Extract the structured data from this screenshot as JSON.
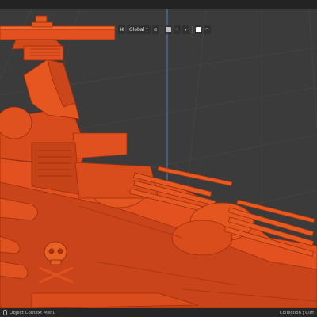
{
  "header_tools": {
    "transform_orientation": "Global",
    "transform_orientation_icon": "orientation-icon",
    "chevron_icon": "chevron-down-icon",
    "pivot_icon": "pivot-icon",
    "snap_icon": "snap-magnet-icon",
    "snap_target_icon": "snap-target-icon",
    "proportional_icon": "proportional-edit-icon",
    "falloff_icon": "falloff-curve-icon"
  },
  "statusbar": {
    "left_label": "Object Context Menu",
    "mouse_icon": "mouse-right-click-icon",
    "right_label": "Collection | Cliff"
  },
  "viewport": {
    "model_color": "#e2511f",
    "background_color": "#3b3b3b",
    "grid_color": "#474747",
    "y_axis_color": "#4f7fbf"
  }
}
